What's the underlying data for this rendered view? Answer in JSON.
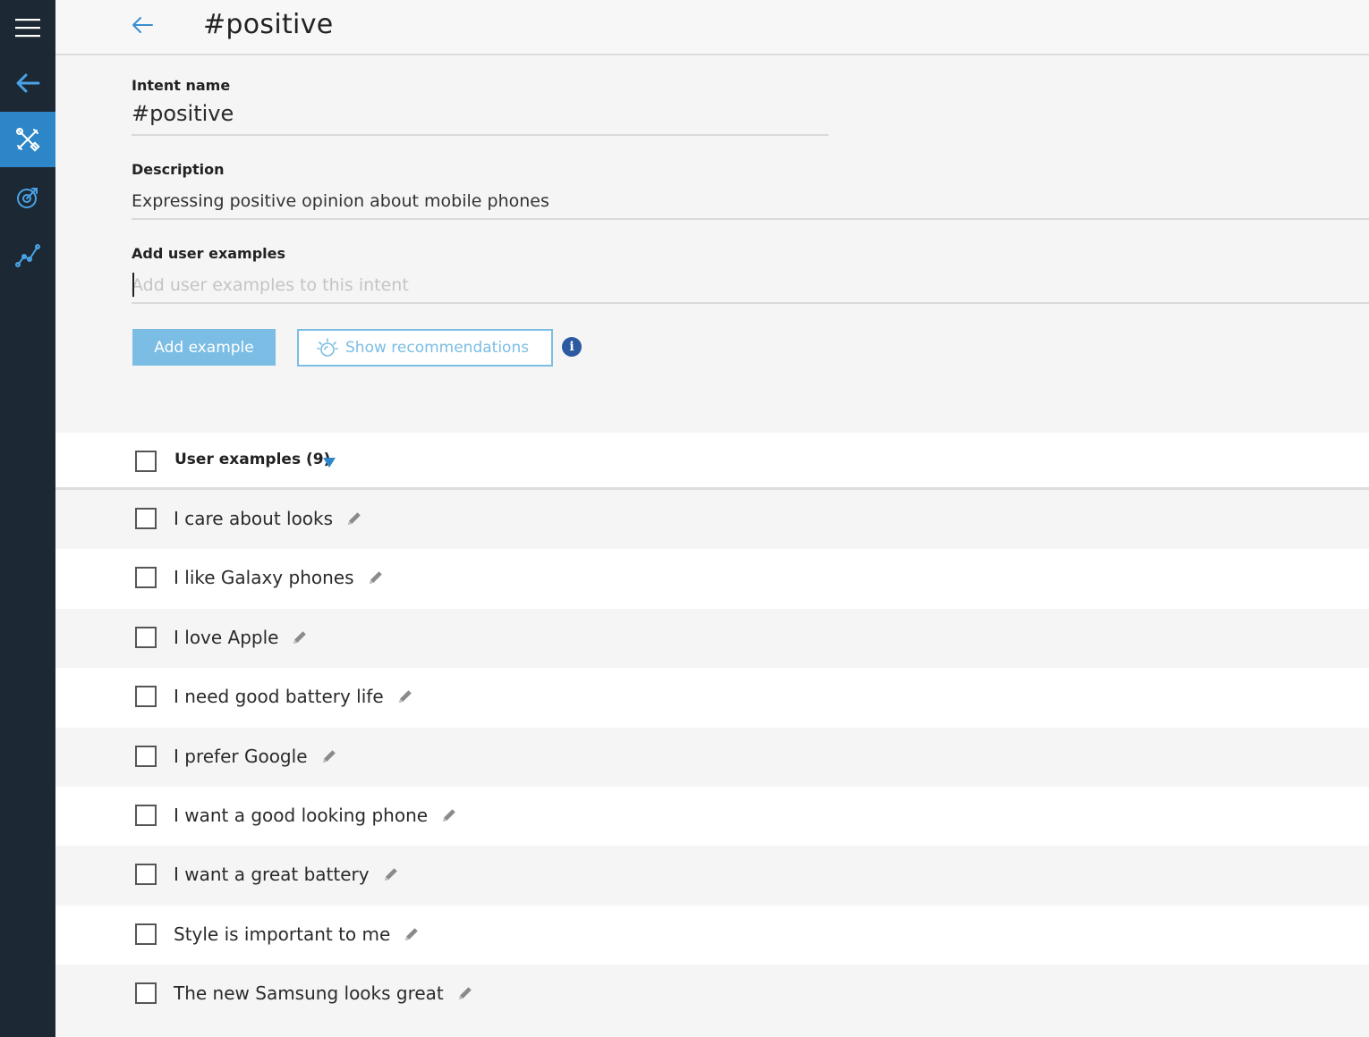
{
  "rail": {
    "items": [
      {
        "icon": "menu-icon"
      },
      {
        "icon": "back-arrow-icon"
      },
      {
        "icon": "tools-icon",
        "active": true
      },
      {
        "icon": "target-icon"
      },
      {
        "icon": "analytics-icon"
      }
    ]
  },
  "header": {
    "title": "#positive"
  },
  "form": {
    "intent_label": "Intent name",
    "intent_value": "#positive",
    "description_label": "Description",
    "description_value": "Expressing positive opinion about mobile phones",
    "examples_label": "Add user examples",
    "examples_placeholder": "Add user examples to this intent",
    "add_button": "Add example",
    "recommend_button": "Show recommendations"
  },
  "list": {
    "header": "User examples (9)",
    "items": [
      "I care about looks",
      "I like Galaxy phones",
      "I love Apple",
      "I need good battery life",
      "I prefer Google",
      "I want a good looking phone",
      "I want a great battery",
      "Style is important to me",
      "The new Samsung looks great"
    ]
  },
  "colors": {
    "rail_bg": "#1c2833",
    "accent": "#2d86c7",
    "button_light": "#7bbde4",
    "info": "#2c5aa0"
  }
}
